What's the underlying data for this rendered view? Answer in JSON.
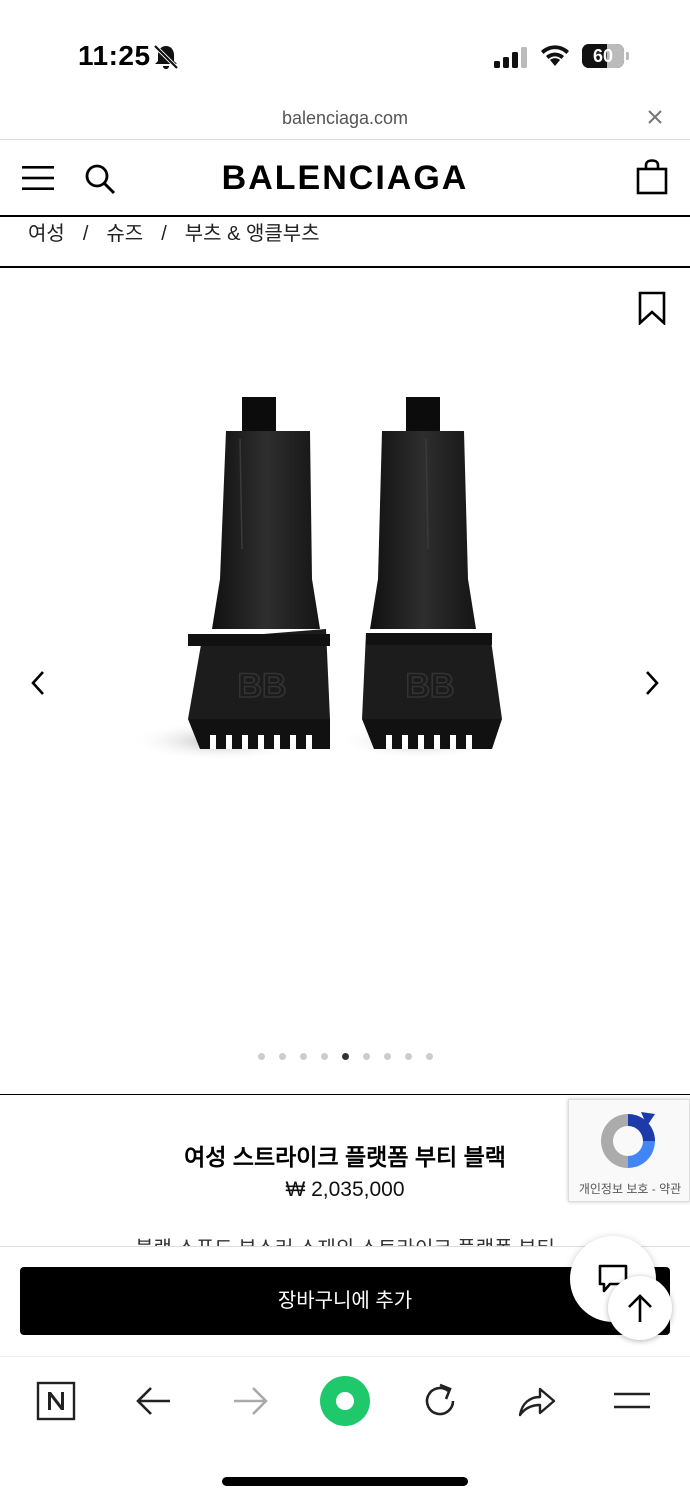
{
  "status_bar": {
    "time": "11:25",
    "battery_level": "60",
    "icons": [
      "bell-slash-icon",
      "cellular-signal-icon",
      "wifi-icon",
      "battery-icon"
    ]
  },
  "browser": {
    "url": "balenciaga.com"
  },
  "header": {
    "brand": "BALENCIAGA"
  },
  "breadcrumb": {
    "items": [
      "여성",
      "슈즈",
      "부츠 & 앵클부츠"
    ],
    "separator": "/"
  },
  "gallery": {
    "image_count": 9,
    "active_index": 4
  },
  "product": {
    "title": "여성 스트라이크 플랫폼 부티 블랙",
    "price": "₩ 2,035,000",
    "description_partial": "블랙 스푸드 부스러 스재의 스트라이크 플랫폼 부티"
  },
  "recaptcha": {
    "label": "개인정보 보호 - 약관"
  },
  "cart": {
    "button_label": "장바구니에 추가"
  },
  "colors": {
    "accent_green": "#1fc96b",
    "black": "#000000"
  }
}
